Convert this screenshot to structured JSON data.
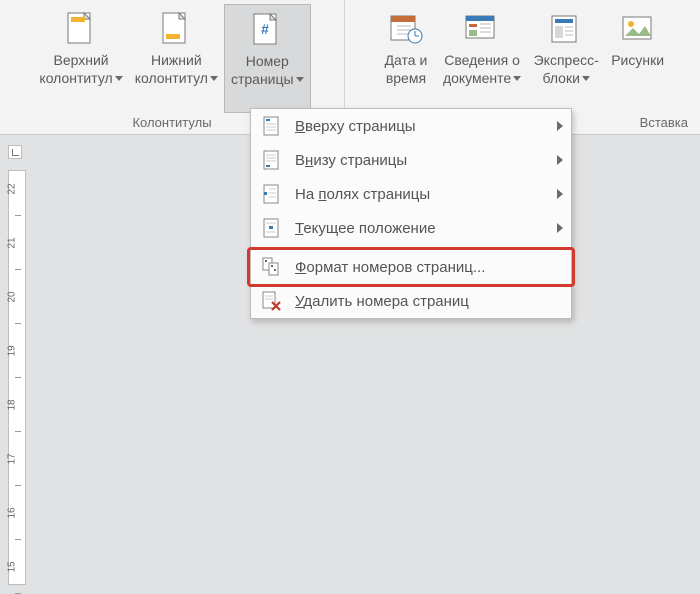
{
  "ribbon": {
    "groups": [
      {
        "label": "Колонтитулы",
        "buttons": [
          {
            "name": "header-button",
            "line1": "Верхний",
            "line2": "колонтитул",
            "dropdown": true
          },
          {
            "name": "footer-button",
            "line1": "Нижний",
            "line2": "колонтитул",
            "dropdown": true
          },
          {
            "name": "page-number-button",
            "line1": "Номер",
            "line2": "страницы",
            "dropdown": true,
            "active": true
          }
        ]
      },
      {
        "label": "Вставка",
        "buttons": [
          {
            "name": "date-time-button",
            "line1": "Дата и",
            "line2": "время",
            "dropdown": false
          },
          {
            "name": "document-info-button",
            "line1": "Сведения о",
            "line2": "документе",
            "dropdown": true
          },
          {
            "name": "quick-parts-button",
            "line1": "Экспресс-",
            "line2": "блоки",
            "dropdown": true
          },
          {
            "name": "pictures-button",
            "line1": "Рисунки",
            "line2": "",
            "dropdown": false
          }
        ]
      }
    ]
  },
  "menu": {
    "items": [
      {
        "name": "top-of-page",
        "label": "Вверху страницы",
        "underlineChar": "В",
        "rest": "верху страницы",
        "submenu": true
      },
      {
        "name": "bottom-of-page",
        "label": "Внизу страницы",
        "underlinePre": "В",
        "underlineChar": "н",
        "rest": "изу страницы",
        "submenu": true
      },
      {
        "name": "page-margins",
        "label": "На полях страницы",
        "underlinePre": "На ",
        "underlineChar": "п",
        "rest": "олях страницы",
        "submenu": true
      },
      {
        "name": "current-position",
        "label": "Текущее положение",
        "underlineChar": "Т",
        "rest": "екущее положение",
        "submenu": true
      },
      {
        "sep": true
      },
      {
        "name": "format-page-numbers",
        "label": "Формат номеров страниц...",
        "underlineChar": "Ф",
        "rest": "ормат номеров страниц...",
        "highlighted": true
      },
      {
        "name": "remove-page-numbers",
        "label": "Удалить номера страниц",
        "underlineChar": "У",
        "rest": "далить номера страниц"
      }
    ]
  },
  "ruler": {
    "ticks": [
      "22",
      "21",
      "20",
      "19",
      "18",
      "17",
      "16",
      "15"
    ]
  }
}
